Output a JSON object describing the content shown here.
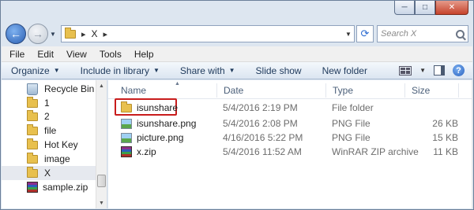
{
  "caption": {
    "min": "─",
    "max": "□",
    "close": "✕"
  },
  "address": {
    "breadcrumb": [
      "▸",
      "X",
      "▸"
    ],
    "search_placeholder": "Search X"
  },
  "menu": [
    "File",
    "Edit",
    "View",
    "Tools",
    "Help"
  ],
  "commands": [
    "Organize",
    "Include in library",
    "Share with",
    "Slide show",
    "New folder"
  ],
  "columns": {
    "name": "Name",
    "date": "Date",
    "type": "Type",
    "size": "Size"
  },
  "nav": [
    {
      "label": "Recycle Bin",
      "icon": "recycle-bin-icon"
    },
    {
      "label": "1",
      "icon": "folder-icon"
    },
    {
      "label": "2",
      "icon": "folder-icon"
    },
    {
      "label": "file",
      "icon": "folder-icon"
    },
    {
      "label": "Hot Key",
      "icon": "folder-icon"
    },
    {
      "label": "image",
      "icon": "folder-icon"
    },
    {
      "label": "X",
      "icon": "folder-icon",
      "selected": true
    },
    {
      "label": "sample.zip",
      "icon": "zip-icon"
    }
  ],
  "files": [
    {
      "name": "isunshare",
      "date": "5/4/2016 2:19 PM",
      "type": "File folder",
      "size": "",
      "icon": "folder-icon",
      "highlighted": true
    },
    {
      "name": "isunshare.png",
      "date": "5/4/2016 2:08 PM",
      "type": "PNG File",
      "size": "26 KB",
      "icon": "image-file-icon"
    },
    {
      "name": "picture.png",
      "date": "4/16/2016 5:22 PM",
      "type": "PNG File",
      "size": "15 KB",
      "icon": "image-file-icon"
    },
    {
      "name": "x.zip",
      "date": "5/4/2016 11:52 AM",
      "type": "WinRAR ZIP archive",
      "size": "11 KB",
      "icon": "zip-icon"
    }
  ],
  "colors": {
    "accent": "#1e395b",
    "highlight_border": "#c81c1c",
    "selection": "#e6e9ef"
  }
}
